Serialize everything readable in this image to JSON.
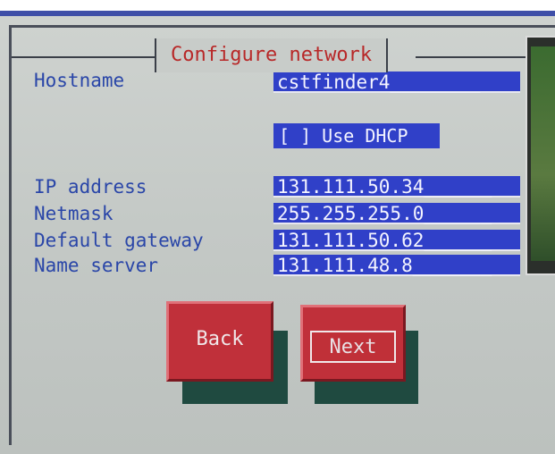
{
  "dialog": {
    "title": "Configure network"
  },
  "form": {
    "hostname": {
      "label": "Hostname",
      "value": "cstfinder4________"
    },
    "dhcp": {
      "label": "[ ] Use DHCP",
      "checked": false
    },
    "ip_address": {
      "label": "IP address",
      "value": "131.111.50.34______"
    },
    "netmask": {
      "label": "Netmask",
      "value": "255.255.255.0______"
    },
    "gateway": {
      "label": "Default gateway",
      "value": "131.111.50.62______"
    },
    "name_server": {
      "label": "Name server",
      "value": "131.111.48.8_______"
    }
  },
  "buttons": {
    "back_label": "Back",
    "next_label": "Next"
  },
  "colors": {
    "label_text": "#2a46a8",
    "field_bg": "#3040c8",
    "button_bg": "#c0303a",
    "title_text": "#b82828"
  }
}
